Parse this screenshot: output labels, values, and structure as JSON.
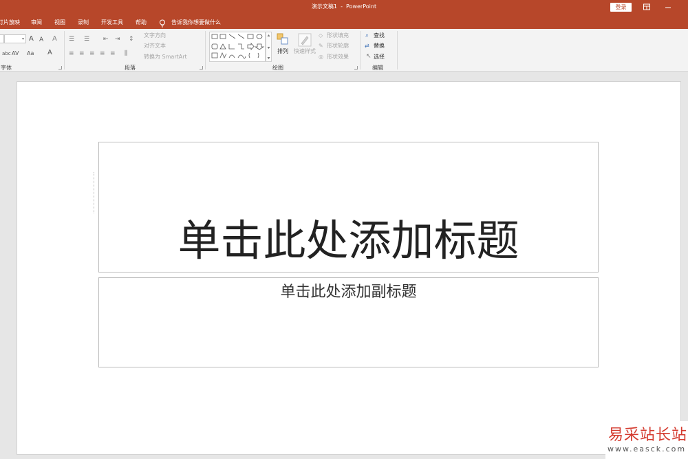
{
  "colors": {
    "accent": "#b7472a",
    "watermark_red": "#d43b2f"
  },
  "window": {
    "title": "演示文稿1  -  PowerPoint",
    "sign_in": "登录",
    "ribbon_display_icon": "ribbon-display-icon",
    "minimize_icon": "minimize-icon"
  },
  "tabs": [
    {
      "label": "灯片放映"
    },
    {
      "label": "审阅"
    },
    {
      "label": "视图"
    },
    {
      "label": "录制"
    },
    {
      "label": "开发工具"
    },
    {
      "label": "帮助"
    }
  ],
  "tell_me": {
    "icon": "lightbulb-icon",
    "text": "告诉我你想要做什么"
  },
  "ribbon": {
    "font": {
      "label": "字体",
      "increase_size": "A",
      "decrease_size": "A",
      "clear_format": "A",
      "strikethrough": "abc",
      "spacing": "AV",
      "change_case": "Aa",
      "font_color": "A"
    },
    "paragraph": {
      "label": "段落",
      "text_direction": "文字方向",
      "align_text": "对齐文本",
      "convert_smartart": "转换为 SmartArt"
    },
    "drawing": {
      "label": "绘图",
      "arrange": "排列",
      "quick_styles": "快速样式",
      "shape_fill": "形状填充",
      "shape_outline": "形状轮廓",
      "shape_effects": "形状效果"
    },
    "editing": {
      "label": "编辑",
      "find": "查找",
      "replace": "替换",
      "select": "选择"
    }
  },
  "slide": {
    "title_prompt": "单击此处添加标题",
    "subtitle_prompt": "单击此处添加副标题"
  },
  "watermark": {
    "name": "易采站长站",
    "url": "www.easck.com"
  }
}
